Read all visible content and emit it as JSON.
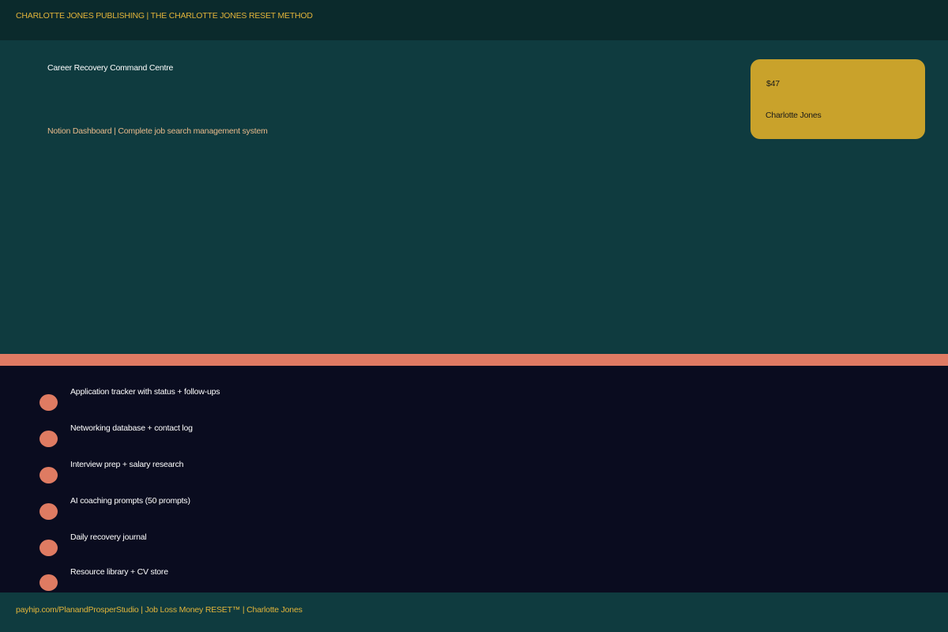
{
  "header": {
    "text": "CHARLOTTE JONES PUBLISHING | THE CHARLOTTE JONES RESET METHOD"
  },
  "hero": {
    "title": "Career Recovery Command Centre",
    "subtitle": "Notion Dashboard | Complete job search management system"
  },
  "price_card": {
    "price": "$47",
    "author": "Charlotte Jones"
  },
  "features": [
    {
      "label": "Application tracker with status + follow-ups"
    },
    {
      "label": "Networking database + contact log"
    },
    {
      "label": "Interview prep + salary research"
    },
    {
      "label": "AI coaching prompts (50 prompts)"
    },
    {
      "label": "Daily recovery journal"
    },
    {
      "label": "Resource library + CV store"
    }
  ],
  "footer": {
    "text": "payhip.com/PlanandProsperStudio | Job Loss Money RESET™ | Charlotte Jones"
  },
  "colors": {
    "top_bar": "#0b2a2c",
    "hero_bg": "#0f3b3f",
    "accent_gold": "#c9a22b",
    "accent_coral": "#e07a63",
    "features_bg": "#0a0c1f",
    "gold_text": "#e2b43a",
    "peach_text": "#e8b98a"
  }
}
